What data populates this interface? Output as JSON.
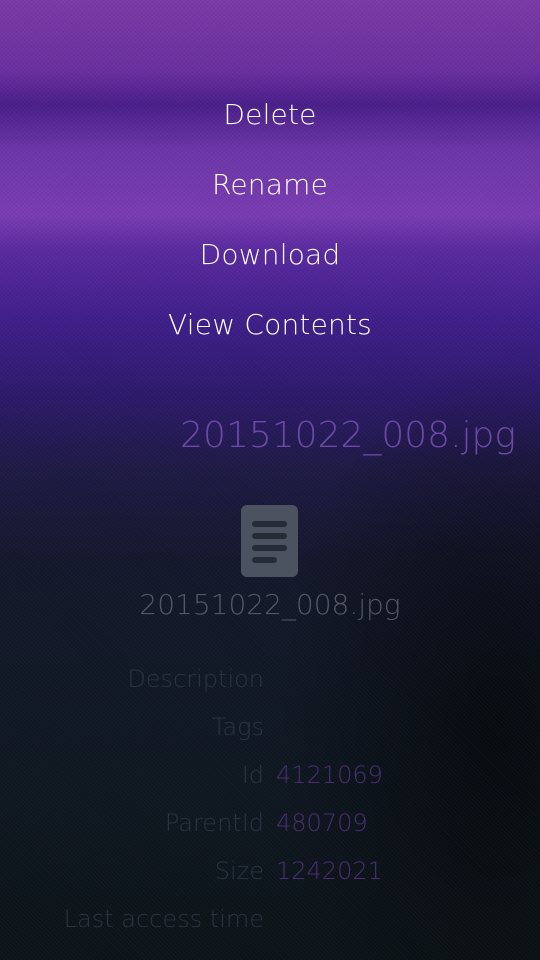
{
  "menu": {
    "items": [
      {
        "label": "Delete"
      },
      {
        "label": "Rename"
      },
      {
        "label": "Download"
      },
      {
        "label": "View Contents"
      }
    ]
  },
  "page": {
    "header_title": "20151022_008.jpg",
    "file_icon": "document-icon",
    "file_name": "20151022_008.jpg"
  },
  "details": [
    {
      "label": "Description",
      "value": ""
    },
    {
      "label": "Tags",
      "value": ""
    },
    {
      "label": "Id",
      "value": "4121069"
    },
    {
      "label": "ParentId",
      "value": "480709"
    },
    {
      "label": "Size",
      "value": "1242021"
    },
    {
      "label": "Last access time",
      "value": ""
    }
  ],
  "colors": {
    "menu_text": "#ffffff",
    "header_text": "#6a4aa6",
    "value_text": "#4a2e70",
    "label_text": "#2a3442"
  }
}
